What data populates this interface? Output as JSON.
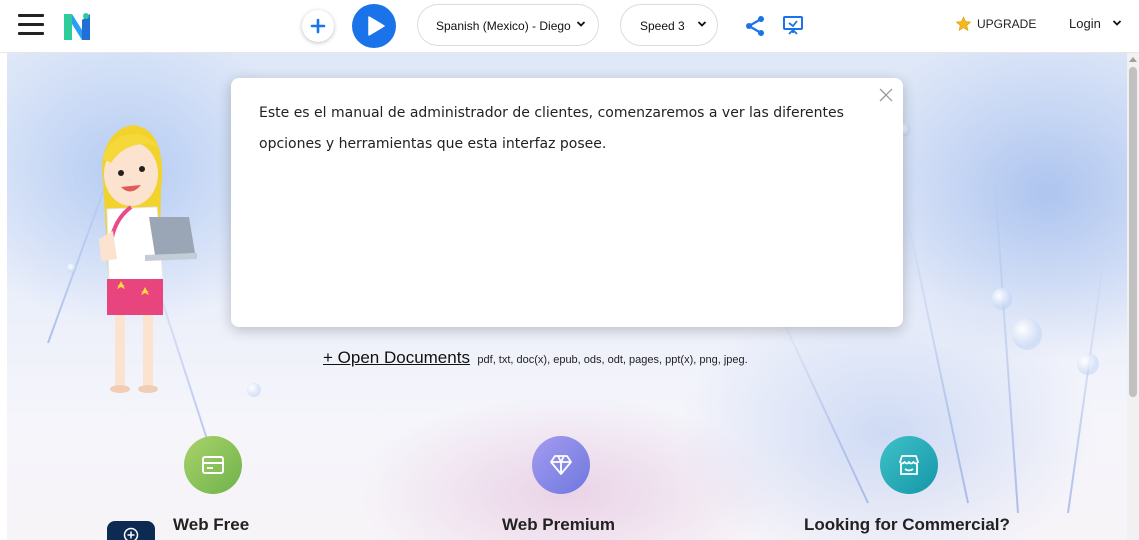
{
  "toolbar": {
    "voice": "Spanish (Mexico) - Diego",
    "speed": "Speed 3",
    "upgrade": "UPGRADE",
    "login": "Login"
  },
  "icons": {
    "menu": "hamburger-icon",
    "add": "plus-icon",
    "play": "play-icon",
    "share": "share-icon",
    "present": "presentation-icon",
    "upgrade": "star-icon",
    "close": "close-icon"
  },
  "dialog": {
    "message": "Este es el manual de administrador de clientes, comenzaremos a ver las diferentes opciones y herramientas que esta interfaz posee."
  },
  "hero": {
    "open_documents": "+ Open Documents",
    "formats": "pdf, txt, doc(x), epub, ods, odt, pages, ppt(x), png, jpeg."
  },
  "plans": [
    {
      "title": "Web Free",
      "icon": "card-icon"
    },
    {
      "title": "Web Premium",
      "icon": "diamond-icon"
    },
    {
      "title": "Looking for Commercial?",
      "icon": "store-icon"
    }
  ],
  "colors": {
    "accent": "#1a73e8",
    "free": "#6fb24b",
    "premium": "#6e78de",
    "commercial": "#1596a8",
    "fab": "#0d2b52",
    "star": "#f5b81a"
  }
}
